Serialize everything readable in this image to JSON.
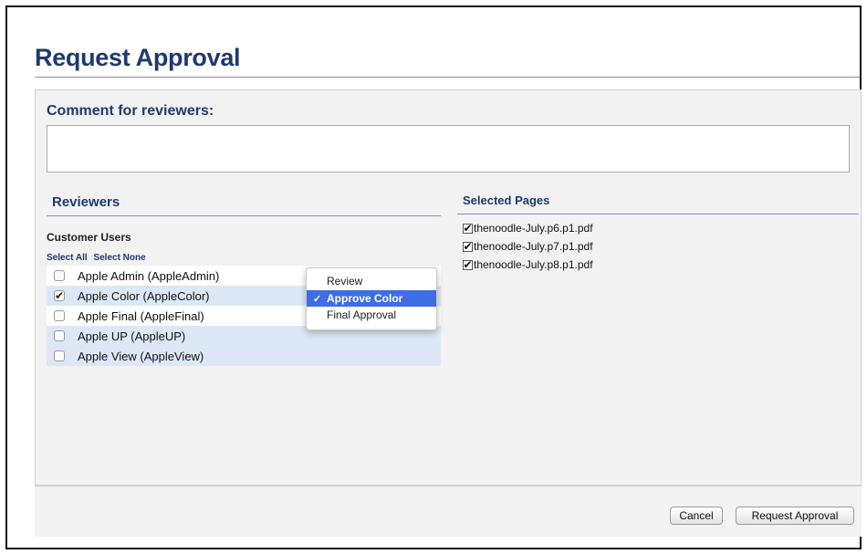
{
  "page": {
    "title": "Request Approval"
  },
  "comment": {
    "label": "Comment for reviewers:",
    "value": ""
  },
  "reviewers": {
    "title": "Reviewers",
    "group_label": "Customer Users",
    "select_all": "Select All",
    "select_none": "Select None",
    "users": [
      {
        "label": "Apple Admin (AppleAdmin)",
        "checked": false
      },
      {
        "label": "Apple Color (AppleColor)",
        "checked": true
      },
      {
        "label": "Apple Final (AppleFinal)",
        "checked": false
      },
      {
        "label": "Apple UP (AppleUP)",
        "checked": false
      },
      {
        "label": "Apple View (AppleView)",
        "checked": false
      }
    ]
  },
  "role_popup": {
    "options": [
      "Review",
      "Approve Color",
      "Final Approval"
    ],
    "selected": "Approve Color",
    "check_glyph": "✓"
  },
  "selected_pages": {
    "title": "Selected Pages",
    "pages": [
      {
        "label": "thenoodle-July.p6.p1.pdf",
        "checked": true
      },
      {
        "label": "thenoodle-July.p7.p1.pdf",
        "checked": true
      },
      {
        "label": "thenoodle-July.p8.p1.pdf",
        "checked": true
      }
    ]
  },
  "buttons": {
    "cancel": "Cancel",
    "request": "Request Approval"
  },
  "colors": {
    "heading": "#1e3a6e",
    "selection": "#3d6ee6",
    "row_highlight": "#dce8f7"
  }
}
